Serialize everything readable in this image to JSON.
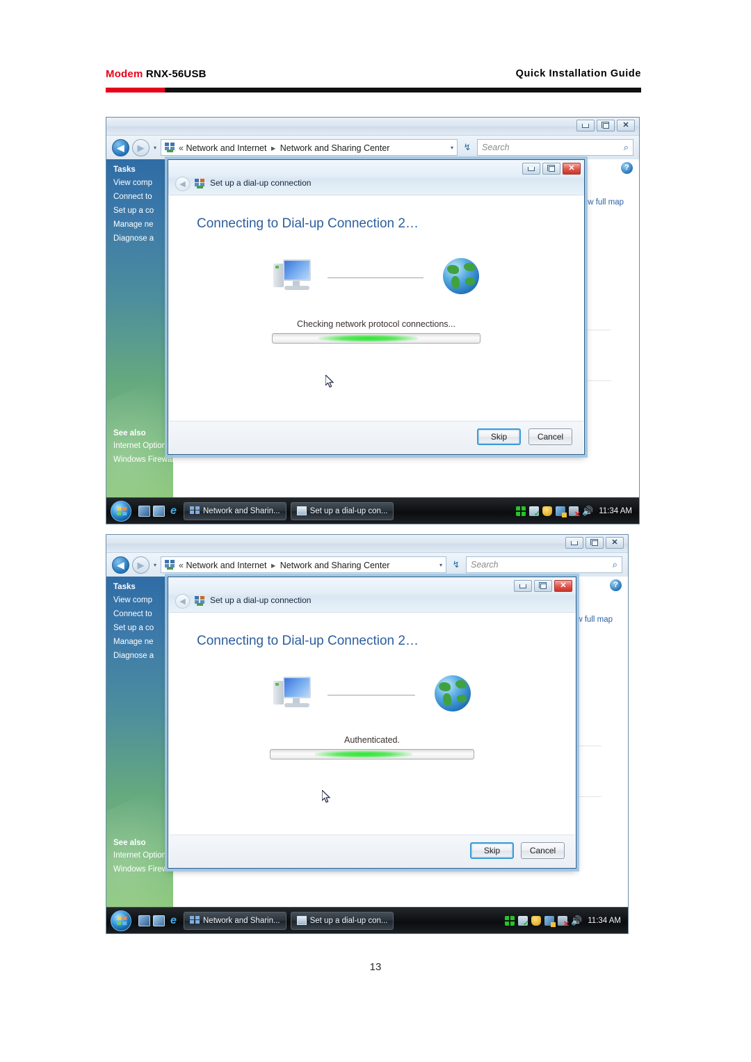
{
  "page": {
    "header_brand": "Modem",
    "header_model": "RNX-56USB",
    "header_right": "Quick Installation Guide",
    "page_number": "13",
    "accent_red": "#e8031a",
    "rule_black": "#101010"
  },
  "window": {
    "titlebar_buttons": {
      "minimize": "–",
      "maximize": "❐",
      "close": "✕"
    },
    "address": {
      "back_icon": "back-arrow",
      "forward_icon": "forward-arrow",
      "history_caret": "▾",
      "breadcrumb_chevron": "«",
      "crumb1": "Network and Internet",
      "crumb_separator": "▸",
      "crumb2": "Network and Sharing Center",
      "dropdown_caret": "▾",
      "refresh_icon": "↯",
      "search_placeholder": "Search",
      "search_value": "",
      "search_icon": "🔎"
    },
    "sidebar": {
      "tasks_heading": "Tasks",
      "tasks": [
        "View comp",
        "Connect to",
        "Set up a co",
        "Manage ne",
        "Diagnose a"
      ],
      "see_also_heading": "See also",
      "see_also": [
        "Internet Options",
        "Windows Firewall"
      ]
    },
    "content": {
      "help_label": "?",
      "view_full_map": "iew full map"
    },
    "taskbar": {
      "start_label": "Start",
      "quick_launch": [
        "show-desktop-icon",
        "flip-3d-icon",
        "internet-explorer-icon"
      ],
      "buttons": [
        {
          "icon": "network-icon",
          "label": "Network and Sharin..."
        },
        {
          "icon": "dialup-icon",
          "label": "Set up a dial-up con..."
        }
      ],
      "tray_icons": [
        "network-tray-icon",
        "check-tray-icon",
        "shield-tray-icon",
        "display-tray-icon",
        "network-disconnected-icon",
        "volume-icon"
      ],
      "clock": "11:34 AM"
    }
  },
  "dialog": {
    "caption": "Set up a dial-up connection",
    "caption_icon": "dialup-icon",
    "back_icon": "back-arrow",
    "titlebar_buttons": {
      "minimize": "–",
      "maximize": "❐",
      "close": "✕"
    },
    "heading": "Connecting to Dial-up Connection 2…",
    "computer_icon": "computer-icon",
    "globe_icon": "globe-icon",
    "buttons": {
      "skip": "Skip",
      "cancel": "Cancel"
    }
  },
  "shots": [
    {
      "id": "shot-1",
      "status_text": "Checking network protocol connections...",
      "progress_style": "indeterminate"
    },
    {
      "id": "shot-2",
      "status_text": "Authenticated.",
      "progress_style": "indeterminate"
    }
  ]
}
